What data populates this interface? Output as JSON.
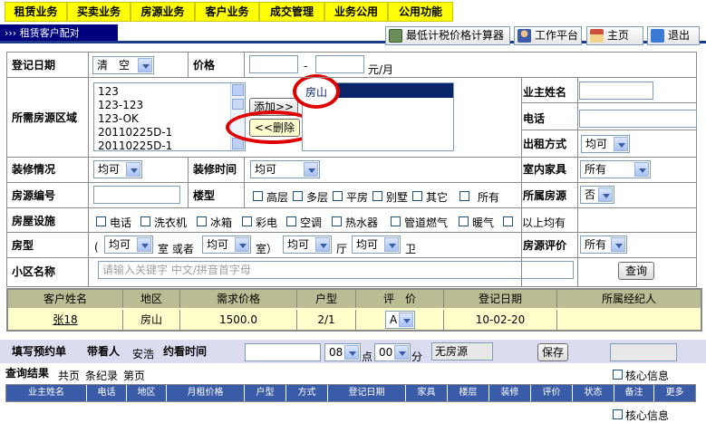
{
  "menu": [
    "租赁业务",
    "买卖业务",
    "房源业务",
    "客户业务",
    "成交管理",
    "业务公用",
    "公用功能"
  ],
  "page_title": "››› 租赁客户配对",
  "toolbar": {
    "calc": "最低计税价格计算器",
    "workbench": "工作平台",
    "home": "主页",
    "exit": "退出"
  },
  "form": {
    "reg_date_label": "登记日期",
    "reg_date_value": "清　空",
    "price_label": "价格",
    "price_dash": "-",
    "price_unit": "元/月",
    "area_label": "所需房源区域",
    "area_list": [
      "123",
      "123-123",
      "123-OK",
      "20110225D-1",
      "20110225D-1"
    ],
    "add_btn": "添加>>",
    "del_btn": "<<删除",
    "selected_area": "房山",
    "owner_name_label": "业主姓名",
    "phone_label": "电话",
    "rent_mode_label": "出租方式",
    "rent_mode_value": "均可",
    "decor_label": "装修情况",
    "decor_value": "均可",
    "decor_time_label": "装修时间",
    "decor_time_value": "均可",
    "furniture_label": "室内家具",
    "furniture_value": "所有",
    "code_label": "房源编号",
    "building_label": "楼型",
    "building_types": [
      "高层",
      "多层",
      "平房",
      "别墅",
      "其它",
      "所有"
    ],
    "own_label": "所属房源",
    "own_value": "否",
    "facility_label": "房屋设施",
    "facilities": [
      "电话",
      "洗衣机",
      "冰箱",
      "彩电",
      "空调",
      "热水器",
      "管道燃气",
      "暖气",
      "以上均有"
    ],
    "type_label": "房型",
    "room_value": "均可",
    "room_text": "室 或者",
    "room2_value": "均可",
    "room2_text": "室）",
    "hall_value": "均可",
    "hall_text": "厅",
    "bath_value": "均可",
    "bath_text": "卫",
    "paren_open": "(",
    "rating_label": "房源评价",
    "rating_value": "所有",
    "community_label": "小区名称",
    "community_placeholder": "请输入关键字 中文/拼音首字母",
    "search_btn": "查询"
  },
  "customer_table": {
    "headers": [
      "客户姓名",
      "地区",
      "需求价格",
      "户型",
      "评　价",
      "登记日期",
      "所属经纪人"
    ],
    "row": {
      "name": "张18",
      "area": "房山",
      "price": "1500.0",
      "type": "2/1",
      "rating": "A",
      "date": "10-02-20",
      "agent": ""
    }
  },
  "appointment": {
    "fill_label": "填写预约单",
    "viewer_label": "带看人",
    "viewer_value": "安浩",
    "time_label": "约看时间",
    "hour_value": "08",
    "hour_unit": "点",
    "min_value": "00",
    "min_unit": "分",
    "status": "无房源",
    "save_btn": "保存"
  },
  "results": {
    "label": "查询结果",
    "total_pages": "共页",
    "records": "条纪录",
    "page": "第页",
    "core_info": "核心信息",
    "headers": [
      "业主姓名",
      "电话",
      "地区",
      "月租价格",
      "户型",
      "方式",
      "登记日期",
      "家具",
      "楼层",
      "装修",
      "评价",
      "状态",
      "备注",
      "更多"
    ]
  }
}
